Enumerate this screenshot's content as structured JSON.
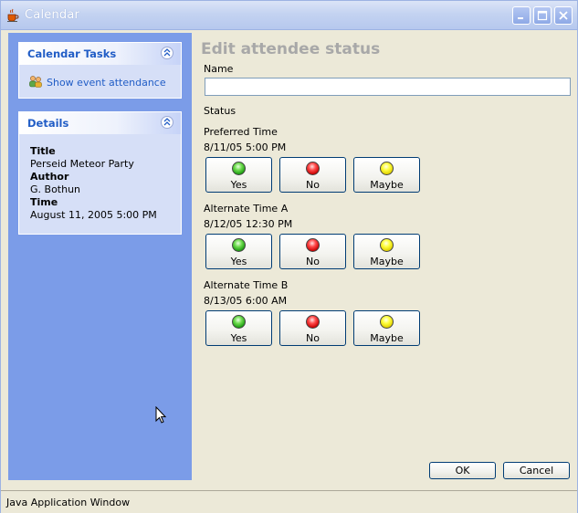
{
  "window": {
    "title": "Calendar",
    "status_text": "Java Application Window"
  },
  "sidebar": {
    "tasks_panel": {
      "title": "Calendar Tasks",
      "link_label": "Show event attendance"
    },
    "details_panel": {
      "title": "Details",
      "rows": [
        {
          "label": "Title",
          "value": "Perseid Meteor Party"
        },
        {
          "label": "Author",
          "value": "G. Bothun"
        },
        {
          "label": "Time",
          "value": "August 11, 2005 5:00 PM"
        }
      ]
    }
  },
  "form": {
    "heading": "Edit attendee status",
    "name_label": "Name",
    "name_value": "",
    "status_label": "Status",
    "options": [
      {
        "label": "Preferred Time",
        "time": "8/11/05 5:00 PM"
      },
      {
        "label": "Alternate Time A",
        "time": "8/12/05 12:30 PM"
      },
      {
        "label": "Alternate Time B",
        "time": "8/13/05 6:00 AM"
      }
    ],
    "choices": {
      "yes": "Yes",
      "no": "No",
      "maybe": "Maybe"
    }
  },
  "dialog": {
    "ok_label": "OK",
    "cancel_label": "Cancel"
  },
  "colors": {
    "sidebar_bg": "#7b9ce8",
    "panel_title": "#215dc6",
    "heading_gray": "#a8a8a8"
  }
}
